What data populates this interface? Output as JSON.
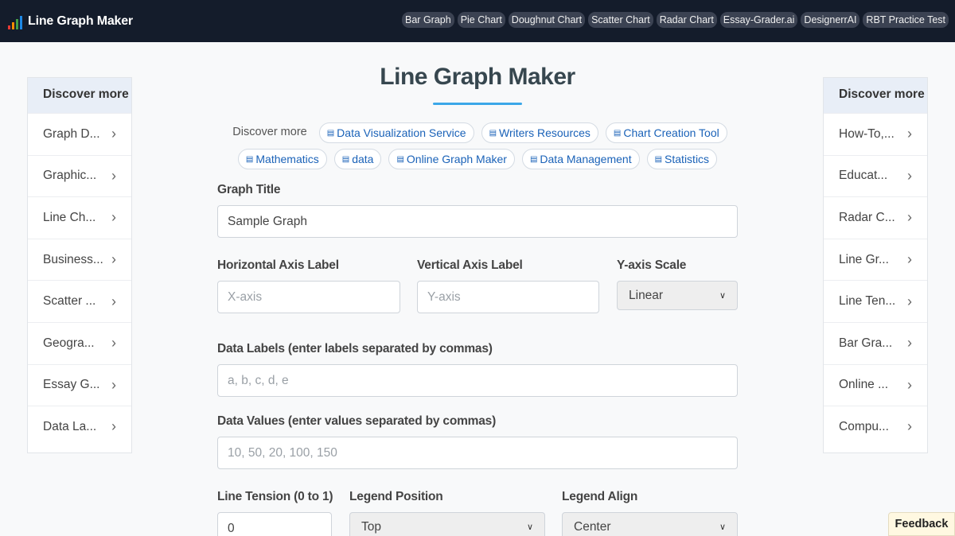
{
  "app": {
    "title": "Line Graph Maker",
    "icon": "bar-chart-icon"
  },
  "nav": [
    "Bar Graph",
    "Pie Chart",
    "Doughnut Chart",
    "Scatter Chart",
    "Radar Chart",
    "Essay-Grader.ai",
    "DesignerrAI",
    "RBT Practice Test"
  ],
  "left_panel": {
    "heading": "Discover more",
    "items": [
      "Graph D...",
      "Graphic...",
      "Line Ch...",
      "Business...",
      "Scatter ...",
      "Geogra...",
      "Essay G...",
      "Data La..."
    ]
  },
  "right_panel": {
    "heading": "Discover more",
    "items": [
      "How-To,...",
      "Educat...",
      "Radar C...",
      "Line Gr...",
      "Line Ten...",
      "Bar Gra...",
      "Online ...",
      "Compu..."
    ]
  },
  "main": {
    "title": "Line Graph Maker",
    "discover_label": "Discover more",
    "chips": [
      "Data Visualization Service",
      "Writers Resources",
      "Chart Creation Tool",
      "Mathematics",
      "data",
      "Online Graph Maker",
      "Data Management",
      "Statistics"
    ],
    "form": {
      "graph_title_label": "Graph Title",
      "graph_title_value": "Sample Graph",
      "h_axis_label": "Horizontal Axis Label",
      "h_axis_placeholder": "X-axis",
      "v_axis_label": "Vertical Axis Label",
      "v_axis_placeholder": "Y-axis",
      "y_scale_label": "Y-axis Scale",
      "y_scale_value": "Linear",
      "data_labels_label": "Data Labels (enter labels separated by commas)",
      "data_labels_placeholder": "a, b, c, d, e",
      "data_values_label": "Data Values (enter values separated by commas)",
      "data_values_placeholder": "10, 50, 20, 100, 150",
      "tension_label": "Line Tension (0 to 1)",
      "tension_value": "0",
      "legend_pos_label": "Legend Position",
      "legend_pos_value": "Top",
      "legend_align_label": "Legend Align",
      "legend_align_value": "Center"
    }
  },
  "feedback": "Feedback",
  "colors": {
    "nav_bg": "#141c2b",
    "accent": "#3ba7e8",
    "chip_text": "#1a62b8"
  }
}
